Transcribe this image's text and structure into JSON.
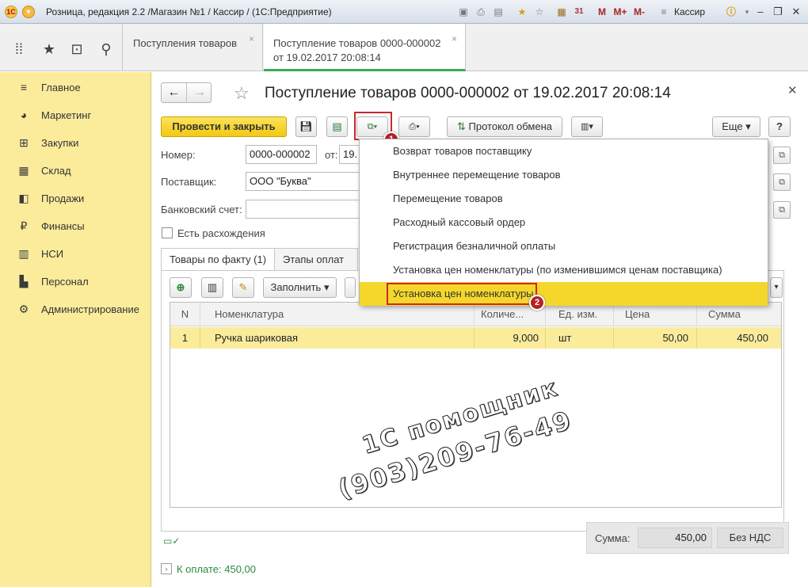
{
  "titlebar": {
    "app_title": "Розница, редакция 2.2 /Магазин №1 / Кассир /  (1С:Предприятие)",
    "user": "Кассир",
    "icons": [
      "logo-icon",
      "menu-icon",
      "link-icon",
      "print-icon",
      "history-icon",
      "favorite-add-icon",
      "favorites-icon",
      "calculator-icon",
      "calendar-icon",
      "memory-icon",
      "user-icon",
      "info-icon",
      "minimize-icon",
      "restore-icon",
      "close-icon"
    ],
    "calendar_num": "31",
    "mem_labels": [
      "M",
      "M+",
      "M-"
    ]
  },
  "tabs": [
    {
      "label": "Поступления товаров"
    },
    {
      "label_line1": "Поступление товаров 0000-000002",
      "label_line2": "от 19.02.2017 20:08:14"
    }
  ],
  "sidebar": {
    "items": [
      {
        "label": "Главное",
        "icon": "menu-lines-icon"
      },
      {
        "label": "Маркетинг",
        "icon": "pie-chart-icon"
      },
      {
        "label": "Закупки",
        "icon": "cart-icon"
      },
      {
        "label": "Склад",
        "icon": "warehouse-icon"
      },
      {
        "label": "Продажи",
        "icon": "sales-icon"
      },
      {
        "label": "Финансы",
        "icon": "ruble-icon"
      },
      {
        "label": "НСИ",
        "icon": "catalog-icon"
      },
      {
        "label": "Персонал",
        "icon": "person-icon"
      },
      {
        "label": "Администрирование",
        "icon": "gear-icon"
      }
    ]
  },
  "doc": {
    "title": "Поступление товаров 0000-000002 от 19.02.2017 20:08:14"
  },
  "toolbar": {
    "post_close": "Провести и закрыть",
    "exchange_protocol": "Протокол обмена",
    "more": "Еще",
    "help": "?"
  },
  "form": {
    "number_label": "Номер:",
    "number_value": "0000-000002",
    "date_label": "от:",
    "date_value": "19.",
    "supplier_label": "Поставщик:",
    "supplier_value": "ООО \"Буква\"",
    "bank_label": "Банковский счет:",
    "bank_value": "",
    "discrepancy_label": "Есть расхождения",
    "discrepancy_checked": false
  },
  "subtabs": [
    {
      "label": "Товары по факту (1)"
    },
    {
      "label": "Этапы оплат (1"
    }
  ],
  "grid_toolbar": {
    "fill": "Заполнить"
  },
  "table": {
    "columns": [
      "N",
      "Номенклатура",
      "Количе...",
      "Ед. изм.",
      "Цена",
      "Сумма"
    ],
    "rows": [
      {
        "n": "1",
        "item": "Ручка шариковая",
        "qty": "9,000",
        "unit": "шт",
        "price": "50,00",
        "sum": "450,00"
      }
    ]
  },
  "watermark": {
    "line1": "1С помощник",
    "line2": "(903)209-76-49"
  },
  "totals": {
    "sum_label": "Сумма:",
    "sum_value": "450,00",
    "vat": "Без НДС"
  },
  "payment": {
    "label": "К оплате: 450,00"
  },
  "menu": {
    "items": [
      "Возврат товаров поставщику",
      "Внутреннее перемещение товаров",
      "Перемещение товаров",
      "Расходный кассовый ордер",
      "Регистрация безналичной оплаты",
      "Установка цен номенклатуры (по изменившимся ценам поставщика)",
      "Установка цен номенклатуры"
    ],
    "selected_index": 6
  },
  "badges": [
    "1",
    "2"
  ],
  "colors": {
    "sidebar_bg": "#fbec9c",
    "primary_button": "#f2c812",
    "menu_selected": "#f5d72b",
    "highlight_red": "#c8282c",
    "active_tab_underline": "#3ba85a",
    "payment_text": "#2a8c3a"
  }
}
